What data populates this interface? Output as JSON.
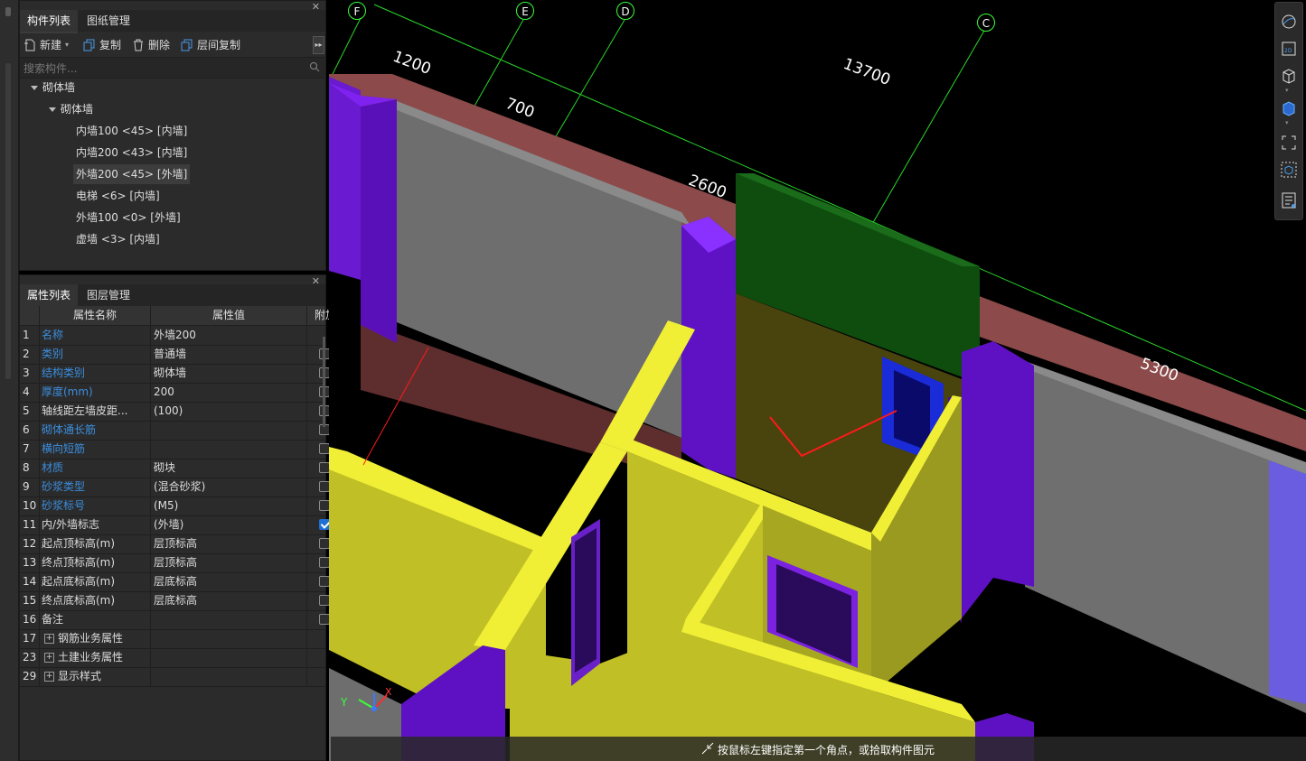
{
  "component_panel": {
    "tabs": [
      "构件列表",
      "图纸管理"
    ],
    "toolbar": {
      "new": "新建",
      "copy": "复制",
      "delete": "删除",
      "floor_copy": "层间复制"
    },
    "search_placeholder": "搜索构件...",
    "tree": {
      "root": "砌体墙",
      "group": "砌体墙",
      "items": [
        "内墙100 <45> [内墙]",
        "内墙200 <43> [内墙]",
        "外墙200 <45> [外墙]",
        "电梯 <6> [内墙]",
        "外墙100 <0> [外墙]",
        "虚墙 <3> [内墙]"
      ],
      "selected_index": 2
    }
  },
  "property_panel": {
    "tabs": [
      "属性列表",
      "图层管理"
    ],
    "headers": [
      "属性名称",
      "属性值",
      "附加"
    ],
    "rows": [
      {
        "num": "1",
        "name": "名称",
        "value": "外墙200",
        "blue": true,
        "checkbox": "none"
      },
      {
        "num": "2",
        "name": "类别",
        "value": "普通墙",
        "blue": true,
        "checkbox": "off"
      },
      {
        "num": "3",
        "name": "结构类别",
        "value": "砌体墙",
        "blue": true,
        "checkbox": "off"
      },
      {
        "num": "4",
        "name": "厚度(mm)",
        "value": "200",
        "blue": true,
        "checkbox": "off"
      },
      {
        "num": "5",
        "name": "轴线距左墙皮距...",
        "value": "(100)",
        "blue": false,
        "checkbox": "off"
      },
      {
        "num": "6",
        "name": "砌体通长筋",
        "value": "",
        "blue": true,
        "checkbox": "off"
      },
      {
        "num": "7",
        "name": "横向短筋",
        "value": "",
        "blue": true,
        "checkbox": "off"
      },
      {
        "num": "8",
        "name": "材质",
        "value": "砌块",
        "blue": true,
        "checkbox": "off"
      },
      {
        "num": "9",
        "name": "砂浆类型",
        "value": "(混合砂浆)",
        "blue": true,
        "checkbox": "off"
      },
      {
        "num": "10",
        "name": "砂浆标号",
        "value": "(M5)",
        "blue": true,
        "checkbox": "off"
      },
      {
        "num": "11",
        "name": "内/外墙标志",
        "value": "(外墙)",
        "blue": false,
        "checkbox": "on"
      },
      {
        "num": "12",
        "name": "起点顶标高(m)",
        "value": "层顶标高",
        "blue": false,
        "checkbox": "off"
      },
      {
        "num": "13",
        "name": "终点顶标高(m)",
        "value": "层顶标高",
        "blue": false,
        "checkbox": "off"
      },
      {
        "num": "14",
        "name": "起点底标高(m)",
        "value": "层底标高",
        "blue": false,
        "checkbox": "off"
      },
      {
        "num": "15",
        "name": "终点底标高(m)",
        "value": "层底标高",
        "blue": false,
        "checkbox": "off"
      },
      {
        "num": "16",
        "name": "备注",
        "value": "",
        "blue": false,
        "checkbox": "off"
      },
      {
        "num": "17",
        "name": "钢筋业务属性",
        "value": "",
        "blue": false,
        "checkbox": "none",
        "expand": true
      },
      {
        "num": "23",
        "name": "土建业务属性",
        "value": "",
        "blue": false,
        "checkbox": "none",
        "expand": true
      },
      {
        "num": "29",
        "name": "显示样式",
        "value": "",
        "blue": false,
        "checkbox": "none",
        "expand": true
      }
    ]
  },
  "viewport": {
    "axis_labels": [
      "F",
      "E",
      "D",
      "C"
    ],
    "dimensions": [
      "1200",
      "700",
      "13700",
      "2600",
      "5300"
    ],
    "gizmo": {
      "y": "Y",
      "x": "X"
    }
  },
  "right_toolbar": {
    "icons": [
      "orbit-icon",
      "2d-view-icon",
      "3d-box-icon",
      "3d-solid-icon",
      "fit-view-icon",
      "selection-view-icon",
      "layer-list-icon"
    ]
  },
  "status": "按鼠标左键指定第一个角点，或拾取构件图元"
}
